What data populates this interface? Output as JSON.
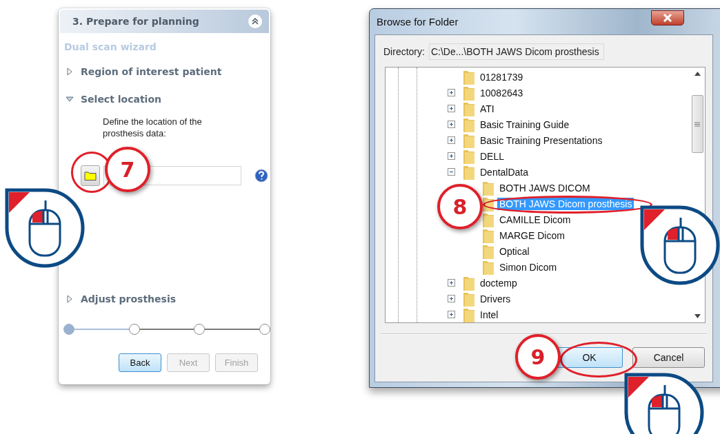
{
  "wizard_panel": {
    "title": "3. Prepare for planning",
    "subtitle": "Dual scan wizard",
    "sections": [
      {
        "title": "Region of interest patient",
        "expanded": false
      },
      {
        "title": "Select location",
        "expanded": true,
        "description": "Define the location of the prosthesis data:"
      },
      {
        "title": "Adjust prosthesis",
        "expanded": false
      }
    ],
    "steps": [
      {
        "done": true
      },
      {
        "done": false
      },
      {
        "done": false
      },
      {
        "done": false
      }
    ],
    "buttons": [
      {
        "label": "Back",
        "disabled": false
      },
      {
        "label": "Next",
        "disabled": true
      },
      {
        "label": "Finish",
        "disabled": true
      }
    ]
  },
  "dialog": {
    "title": "Browse for Folder",
    "directory_label": "Directory:",
    "directory_value": "C:\\De...\\BOTH JAWS Dicom prosthesis",
    "tree": [
      {
        "label": "01281739",
        "selected": false
      },
      {
        "label": "10082643",
        "expanded": false,
        "selected": false
      },
      {
        "label": "ATI",
        "expanded": false,
        "selected": false
      },
      {
        "label": "Basic Training Guide",
        "expanded": false,
        "selected": false
      },
      {
        "label": "Basic Training Presentations",
        "expanded": false,
        "selected": false
      },
      {
        "label": "DELL",
        "expanded": false,
        "selected": false
      },
      {
        "label": "DentalData",
        "expanded": true,
        "selected": false,
        "children": [
          {
            "label": "BOTH JAWS DICOM",
            "selected": false
          },
          {
            "label": "BOTH JAWS Dicom prosthesis",
            "selected": true
          },
          {
            "label": "CAMILLE Dicom",
            "selected": false
          },
          {
            "label": "MARGE Dicom",
            "selected": false
          },
          {
            "label": "Optical",
            "selected": false
          },
          {
            "label": "Simon Dicom",
            "selected": false
          }
        ]
      },
      {
        "label": "doctemp",
        "expanded": false,
        "selected": false
      },
      {
        "label": "Drivers",
        "expanded": false,
        "selected": false
      },
      {
        "label": "Intel",
        "expanded": false,
        "selected": false
      }
    ],
    "buttons": [
      {
        "label": "OK",
        "default": true
      },
      {
        "label": "Cancel",
        "default": false
      }
    ]
  },
  "callouts": [
    {
      "label": "7"
    },
    {
      "label": "8"
    },
    {
      "label": "9"
    }
  ]
}
